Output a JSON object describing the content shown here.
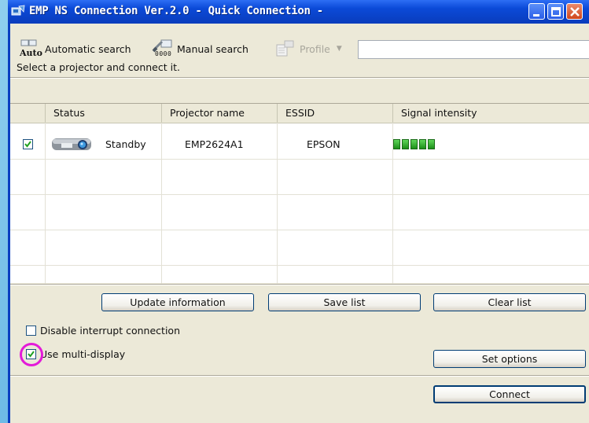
{
  "window": {
    "title": "EMP NS Connection Ver.2.0 - Quick Connection -"
  },
  "toolbar": {
    "automatic_search_label": "Automatic search",
    "automatic_search_icon_text": "Auto",
    "manual_search_label": "Manual search",
    "manual_search_icon_text": "0000",
    "profile_label": "Profile",
    "profile_dropdown_arrow": "▼"
  },
  "hint": "Select a projector and connect it.",
  "table": {
    "columns": [
      "Status",
      "Projector name",
      "ESSID",
      "Signal intensity"
    ],
    "rows": [
      {
        "checked": true,
        "status": "Standby",
        "projector_name": "EMP2624A1",
        "essid": "EPSON",
        "signal_bars": 5
      }
    ]
  },
  "buttons": {
    "update_information": "Update information",
    "save_list": "Save list",
    "clear_list": "Clear list",
    "set_options": "Set options",
    "connect": "Connect"
  },
  "options": {
    "disable_interrupt_label": "Disable interrupt connection",
    "disable_interrupt_checked": false,
    "multi_display_label": "Use multi-display",
    "multi_display_checked": true
  },
  "colors": {
    "titlebar": "#0b4ad8",
    "highlight_circle": "#e31ad8",
    "signal": "#1c8f18"
  }
}
